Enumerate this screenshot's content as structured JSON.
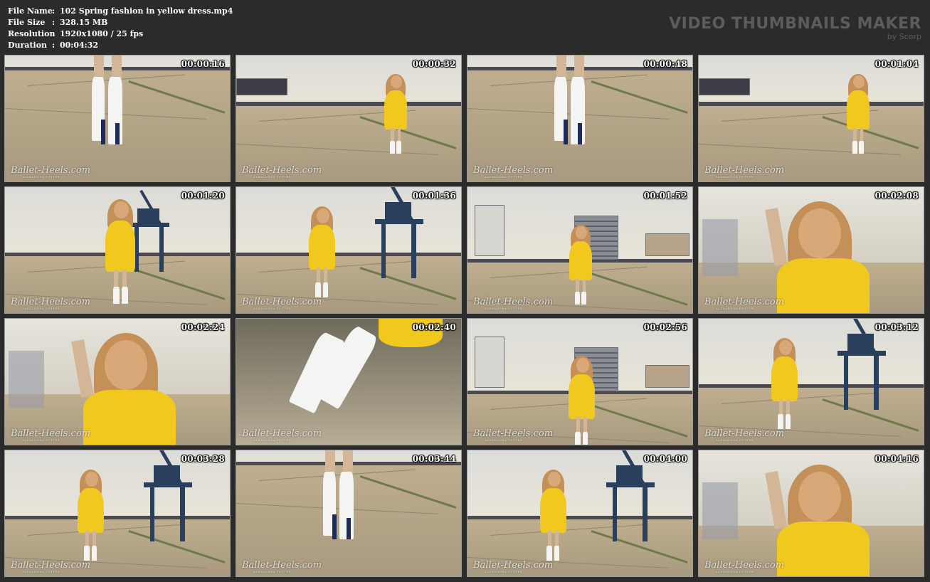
{
  "meta": [
    {
      "key": "File Name",
      "value": "102 Spring fashion in yellow dress.mp4"
    },
    {
      "key": "File Size",
      "value": "328.15 MB"
    },
    {
      "key": "Resolution",
      "value": "1920x1080 / 25 fps"
    },
    {
      "key": "Duration",
      "value": "00:04:32"
    }
  ],
  "meta_sep": ":",
  "brand": {
    "title": "VIDEO THUMBNAILS MAKER",
    "subtitle": "by Scorp"
  },
  "watermark": {
    "main": "Ballet-Heels.com",
    "sub": "ALEXANDRA POTTER"
  },
  "thumbnails": [
    {
      "time": "00:00:16",
      "scene": "closeup-boots"
    },
    {
      "time": "00:00:32",
      "scene": "walk-far"
    },
    {
      "time": "00:00:48",
      "scene": "closeup-boots"
    },
    {
      "time": "00:01:04",
      "scene": "walk-far"
    },
    {
      "time": "00:01:20",
      "scene": "crane-left"
    },
    {
      "time": "00:01:36",
      "scene": "crane-right"
    },
    {
      "time": "00:01:52",
      "scene": "buildings-sit"
    },
    {
      "time": "00:02:08",
      "scene": "portrait-sit"
    },
    {
      "time": "00:02:24",
      "scene": "portrait-arms"
    },
    {
      "time": "00:02:40",
      "scene": "closeup-boot-ground"
    },
    {
      "time": "00:02:56",
      "scene": "buildings-stand"
    },
    {
      "time": "00:03:12",
      "scene": "crane-right"
    },
    {
      "time": "00:03:28",
      "scene": "crane-right"
    },
    {
      "time": "00:03:44",
      "scene": "closeup-boots"
    },
    {
      "time": "00:04:00",
      "scene": "crane-right"
    },
    {
      "time": "00:04:16",
      "scene": "portrait-arms"
    }
  ],
  "colors": {
    "background": "#2b2b2b",
    "dress": "#f0c81e",
    "crane": "#2a3f5c"
  }
}
